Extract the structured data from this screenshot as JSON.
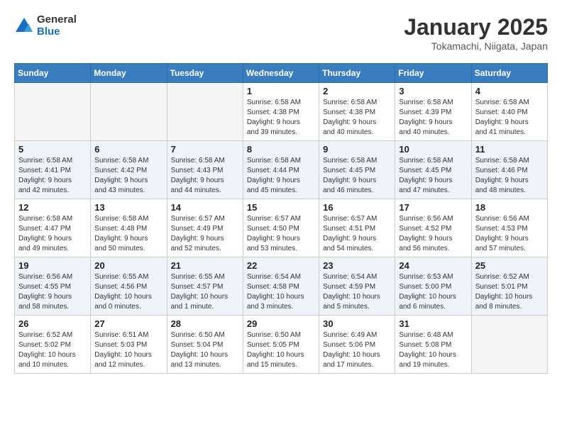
{
  "header": {
    "logo_general": "General",
    "logo_blue": "Blue",
    "title": "January 2025",
    "subtitle": "Tokamachi, Niigata, Japan"
  },
  "weekdays": [
    "Sunday",
    "Monday",
    "Tuesday",
    "Wednesday",
    "Thursday",
    "Friday",
    "Saturday"
  ],
  "weeks": [
    [
      {
        "day": "",
        "info": ""
      },
      {
        "day": "",
        "info": ""
      },
      {
        "day": "",
        "info": ""
      },
      {
        "day": "1",
        "info": "Sunrise: 6:58 AM\nSunset: 4:38 PM\nDaylight: 9 hours\nand 39 minutes."
      },
      {
        "day": "2",
        "info": "Sunrise: 6:58 AM\nSunset: 4:38 PM\nDaylight: 9 hours\nand 40 minutes."
      },
      {
        "day": "3",
        "info": "Sunrise: 6:58 AM\nSunset: 4:39 PM\nDaylight: 9 hours\nand 40 minutes."
      },
      {
        "day": "4",
        "info": "Sunrise: 6:58 AM\nSunset: 4:40 PM\nDaylight: 9 hours\nand 41 minutes."
      }
    ],
    [
      {
        "day": "5",
        "info": "Sunrise: 6:58 AM\nSunset: 4:41 PM\nDaylight: 9 hours\nand 42 minutes."
      },
      {
        "day": "6",
        "info": "Sunrise: 6:58 AM\nSunset: 4:42 PM\nDaylight: 9 hours\nand 43 minutes."
      },
      {
        "day": "7",
        "info": "Sunrise: 6:58 AM\nSunset: 4:43 PM\nDaylight: 9 hours\nand 44 minutes."
      },
      {
        "day": "8",
        "info": "Sunrise: 6:58 AM\nSunset: 4:44 PM\nDaylight: 9 hours\nand 45 minutes."
      },
      {
        "day": "9",
        "info": "Sunrise: 6:58 AM\nSunset: 4:45 PM\nDaylight: 9 hours\nand 46 minutes."
      },
      {
        "day": "10",
        "info": "Sunrise: 6:58 AM\nSunset: 4:45 PM\nDaylight: 9 hours\nand 47 minutes."
      },
      {
        "day": "11",
        "info": "Sunrise: 6:58 AM\nSunset: 4:46 PM\nDaylight: 9 hours\nand 48 minutes."
      }
    ],
    [
      {
        "day": "12",
        "info": "Sunrise: 6:58 AM\nSunset: 4:47 PM\nDaylight: 9 hours\nand 49 minutes."
      },
      {
        "day": "13",
        "info": "Sunrise: 6:58 AM\nSunset: 4:48 PM\nDaylight: 9 hours\nand 50 minutes."
      },
      {
        "day": "14",
        "info": "Sunrise: 6:57 AM\nSunset: 4:49 PM\nDaylight: 9 hours\nand 52 minutes."
      },
      {
        "day": "15",
        "info": "Sunrise: 6:57 AM\nSunset: 4:50 PM\nDaylight: 9 hours\nand 53 minutes."
      },
      {
        "day": "16",
        "info": "Sunrise: 6:57 AM\nSunset: 4:51 PM\nDaylight: 9 hours\nand 54 minutes."
      },
      {
        "day": "17",
        "info": "Sunrise: 6:56 AM\nSunset: 4:52 PM\nDaylight: 9 hours\nand 56 minutes."
      },
      {
        "day": "18",
        "info": "Sunrise: 6:56 AM\nSunset: 4:53 PM\nDaylight: 9 hours\nand 57 minutes."
      }
    ],
    [
      {
        "day": "19",
        "info": "Sunrise: 6:56 AM\nSunset: 4:55 PM\nDaylight: 9 hours\nand 58 minutes."
      },
      {
        "day": "20",
        "info": "Sunrise: 6:55 AM\nSunset: 4:56 PM\nDaylight: 10 hours\nand 0 minutes."
      },
      {
        "day": "21",
        "info": "Sunrise: 6:55 AM\nSunset: 4:57 PM\nDaylight: 10 hours\nand 1 minute."
      },
      {
        "day": "22",
        "info": "Sunrise: 6:54 AM\nSunset: 4:58 PM\nDaylight: 10 hours\nand 3 minutes."
      },
      {
        "day": "23",
        "info": "Sunrise: 6:54 AM\nSunset: 4:59 PM\nDaylight: 10 hours\nand 5 minutes."
      },
      {
        "day": "24",
        "info": "Sunrise: 6:53 AM\nSunset: 5:00 PM\nDaylight: 10 hours\nand 6 minutes."
      },
      {
        "day": "25",
        "info": "Sunrise: 6:52 AM\nSunset: 5:01 PM\nDaylight: 10 hours\nand 8 minutes."
      }
    ],
    [
      {
        "day": "26",
        "info": "Sunrise: 6:52 AM\nSunset: 5:02 PM\nDaylight: 10 hours\nand 10 minutes."
      },
      {
        "day": "27",
        "info": "Sunrise: 6:51 AM\nSunset: 5:03 PM\nDaylight: 10 hours\nand 12 minutes."
      },
      {
        "day": "28",
        "info": "Sunrise: 6:50 AM\nSunset: 5:04 PM\nDaylight: 10 hours\nand 13 minutes."
      },
      {
        "day": "29",
        "info": "Sunrise: 6:50 AM\nSunset: 5:05 PM\nDaylight: 10 hours\nand 15 minutes."
      },
      {
        "day": "30",
        "info": "Sunrise: 6:49 AM\nSunset: 5:06 PM\nDaylight: 10 hours\nand 17 minutes."
      },
      {
        "day": "31",
        "info": "Sunrise: 6:48 AM\nSunset: 5:08 PM\nDaylight: 10 hours\nand 19 minutes."
      },
      {
        "day": "",
        "info": ""
      }
    ]
  ]
}
